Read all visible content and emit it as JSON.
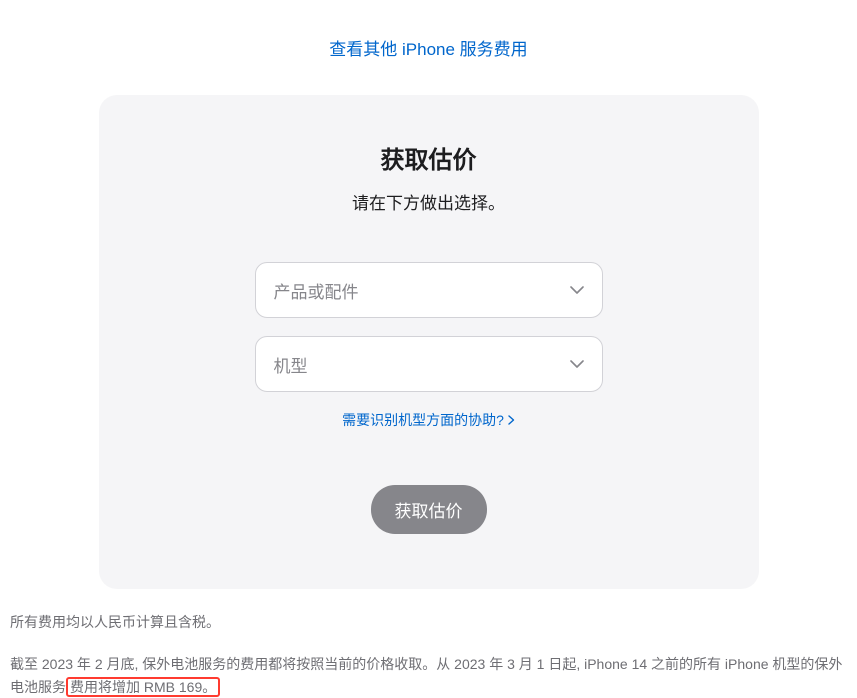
{
  "top_link": "查看其他 iPhone 服务费用",
  "card": {
    "title": "获取估价",
    "subtitle": "请在下方做出选择。",
    "select1_placeholder": "产品或配件",
    "select2_placeholder": "机型",
    "help_link": "需要识别机型方面的协助?",
    "submit_label": "获取估价"
  },
  "footnote": {
    "line1": "所有费用均以人民币计算且含税。",
    "line2_part1": "截至 2023 年 2 月底, 保外电池服务的费用都将按照当前的价格收取。从 2023 年 3 月 1 日起, iPhone 14 之前的所有 iPhone 机型的保外电池服务",
    "line2_highlight": "费用将增加 RMB 169。"
  }
}
